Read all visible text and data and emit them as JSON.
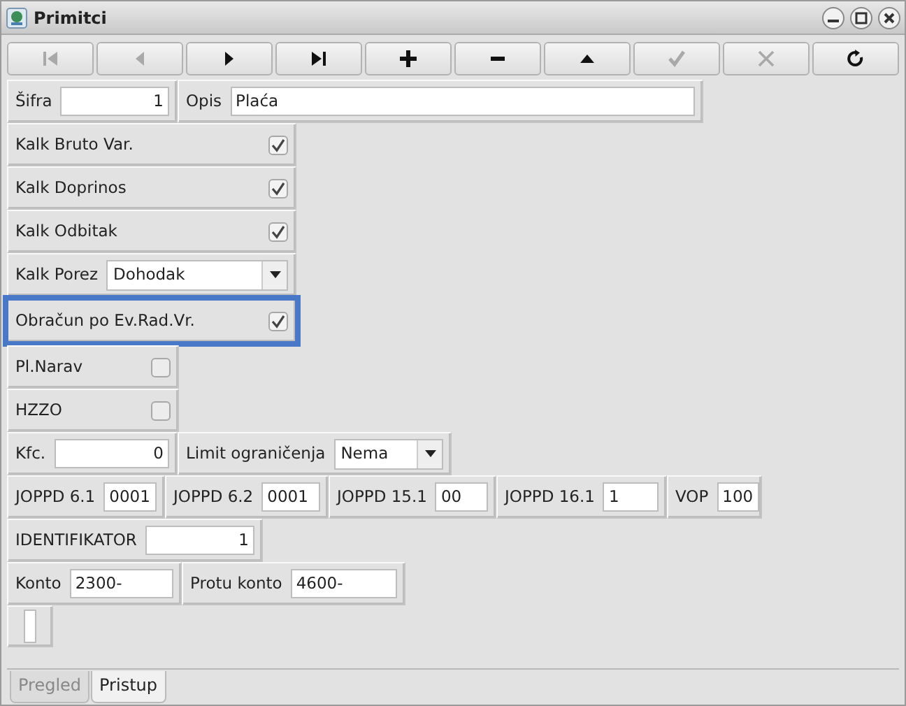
{
  "window": {
    "title": "Primitci"
  },
  "toolbar": [
    {
      "kind": "first",
      "disabled": true
    },
    {
      "kind": "prev",
      "disabled": true
    },
    {
      "kind": "next",
      "disabled": false
    },
    {
      "kind": "last",
      "disabled": false
    },
    {
      "kind": "add",
      "disabled": false
    },
    {
      "kind": "remove",
      "disabled": false
    },
    {
      "kind": "up",
      "disabled": false
    },
    {
      "kind": "confirm",
      "disabled": true
    },
    {
      "kind": "cancel",
      "disabled": true
    },
    {
      "kind": "refresh",
      "disabled": false
    }
  ],
  "rows": [
    {
      "cells": [
        {
          "kind": "number",
          "label": "Šifra",
          "value": "1"
        },
        {
          "kind": "text",
          "label": "Opis",
          "value": "Plaća"
        }
      ]
    },
    {
      "cells": [
        {
          "kind": "checkbox",
          "label": "Kalk Bruto Var.",
          "checked": true,
          "highlighted": false
        }
      ]
    },
    {
      "cells": [
        {
          "kind": "checkbox",
          "label": "Kalk Doprinos",
          "checked": true,
          "highlighted": false
        }
      ]
    },
    {
      "cells": [
        {
          "kind": "checkbox",
          "label": "Kalk Odbitak",
          "checked": true,
          "highlighted": false
        }
      ]
    },
    {
      "cells": [
        {
          "kind": "dropdown",
          "label": "Kalk Porez",
          "value": "Dohodak"
        }
      ]
    },
    {
      "cells": [
        {
          "kind": "checkbox",
          "label": "Obračun po Ev.Rad.Vr.",
          "checked": true,
          "highlighted": true
        }
      ]
    },
    {
      "cells": [
        {
          "kind": "checkbox",
          "label": "Pl.Narav",
          "checked": false,
          "highlighted": false
        }
      ]
    },
    {
      "cells": [
        {
          "kind": "checkbox",
          "label": "HZZO",
          "checked": false,
          "highlighted": false
        }
      ]
    },
    {
      "cells": [
        {
          "kind": "number",
          "label": "Kfc.",
          "value": "0"
        },
        {
          "kind": "dropdown",
          "label": "Limit ograničenja",
          "value": "Nema"
        }
      ]
    },
    {
      "cells": [
        {
          "kind": "text",
          "label": "JOPPD 6.1",
          "value": "0001"
        },
        {
          "kind": "text",
          "label": "JOPPD 6.2",
          "value": "0001"
        },
        {
          "kind": "text",
          "label": "JOPPD 15.1",
          "value": "00"
        },
        {
          "kind": "text",
          "label": "JOPPD 16.1",
          "value": "1"
        },
        {
          "kind": "text",
          "label": "VOP",
          "value": "100"
        }
      ]
    },
    {
      "cells": [
        {
          "kind": "number",
          "label": "IDENTIFIKATOR",
          "value": "1"
        }
      ]
    },
    {
      "cells": [
        {
          "kind": "text",
          "label": "Konto",
          "value": "2300-"
        },
        {
          "kind": "text",
          "label": "Protu konto",
          "value": "4600-"
        }
      ]
    },
    {
      "cells": [
        {
          "kind": "blank"
        }
      ]
    }
  ],
  "tabs": [
    {
      "label": "Pregled",
      "selected": false
    },
    {
      "label": "Pristup",
      "selected": true
    }
  ]
}
